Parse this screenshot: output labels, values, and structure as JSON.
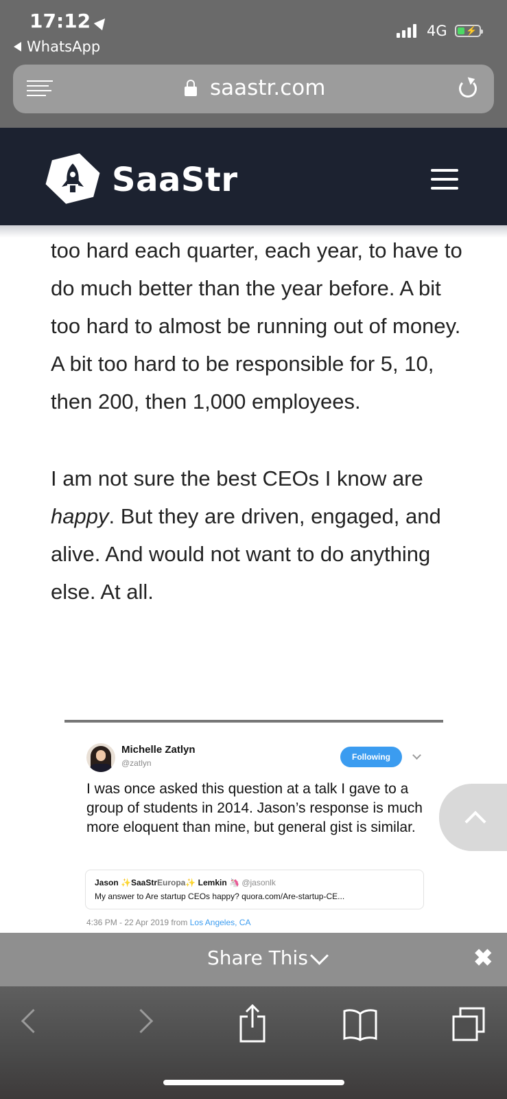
{
  "status_bar": {
    "time": "17:12",
    "back_app": "WhatsApp",
    "network": "4G"
  },
  "browser": {
    "url": "saastr.com"
  },
  "site": {
    "logo_text": "SaaStr"
  },
  "article": {
    "paragraph1": "too hard each quarter, each year, to have to do much better than the year before. A bit too hard to almost be running out of money. A bit too hard to be responsible for 5, 10, then 200, then 1,000 employees.",
    "paragraph2_em": "happy",
    "paragraph2_prefix": "I am not sure the best CEOs I know are ",
    "paragraph2_suffix": ". But they are driven, engaged, and alive. And would not want to do anything else. At all."
  },
  "tweet": {
    "author_name": "Michelle Zatlyn",
    "author_handle": "@zatlyn",
    "follow_label": "Following",
    "text": "I was once asked this question at a talk I gave to a group of students in 2014. Jason’s response is much more eloquent than mine, but general gist is similar.",
    "quoted": {
      "name_part1": "Jason",
      "name_saastr": "SaaStr",
      "name_europa": "Europa",
      "name_part2": "Lemkin",
      "handle": "@jasonlk",
      "text": "My answer to Are startup CEOs happy? quora.com/Are-startup-CE..."
    },
    "meta_time": "4:36 PM - 22 Apr 2019 from ",
    "meta_location": "Los Angeles, CA"
  },
  "share_bar": {
    "label": "Share This"
  },
  "colors": {
    "header_bg": "#1c2230",
    "follow_button": "#3b9cf0",
    "share_bar": "#8f8f8f"
  }
}
